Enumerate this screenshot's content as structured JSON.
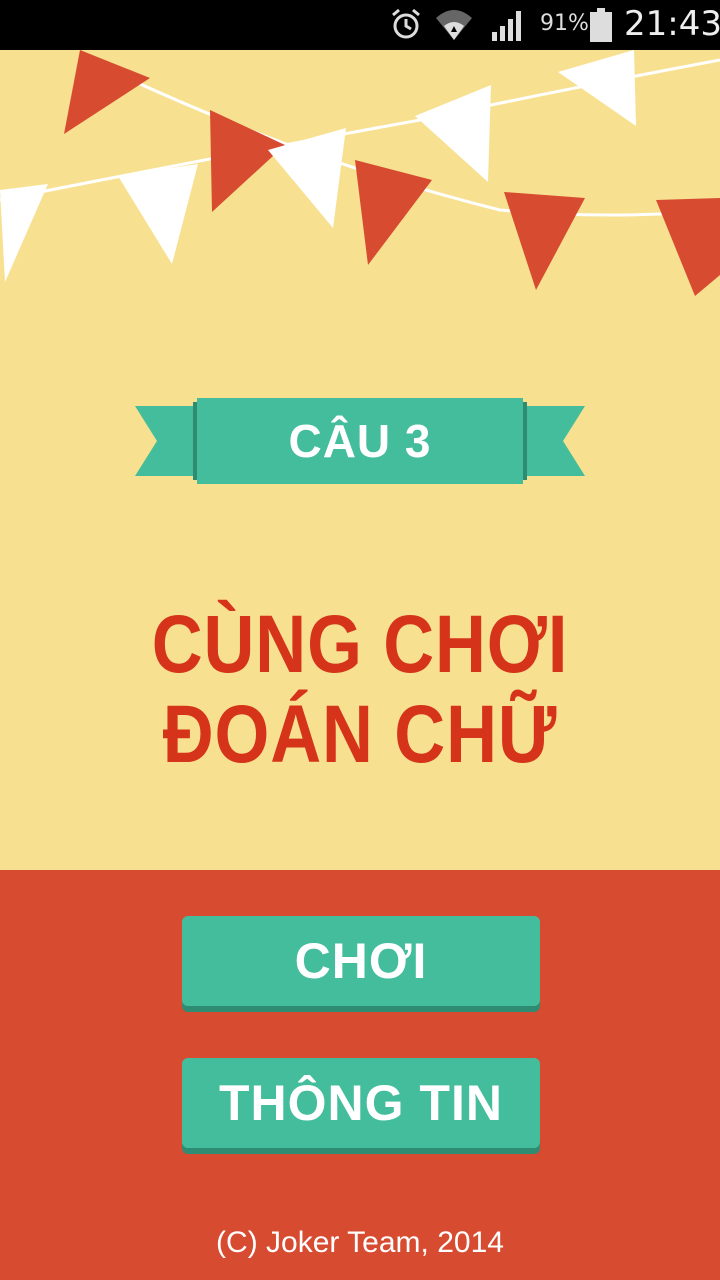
{
  "status_bar": {
    "battery_percent": "91%",
    "clock": "21:43",
    "icons": [
      "alarm-icon",
      "wifi-icon",
      "signal-icon",
      "battery-icon"
    ]
  },
  "colors": {
    "background_top": "#f7e08f",
    "background_bottom": "#d74b31",
    "accent_teal": "#43bd9c",
    "title_red": "#d5331a",
    "flag_red": "#d74b31",
    "flag_white": "#ffffff"
  },
  "level_banner": {
    "label": "CÂU 3"
  },
  "title": {
    "line1": "CÙNG CHƠI",
    "line2": "ĐOÁN CHỮ"
  },
  "buttons": {
    "play": "CHƠI",
    "info": "THÔNG TIN"
  },
  "footer": {
    "copyright": "(C) Joker Team, 2014"
  }
}
